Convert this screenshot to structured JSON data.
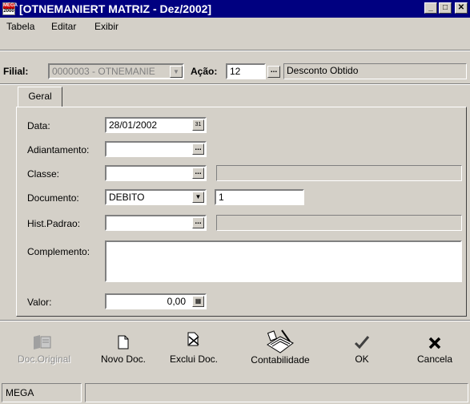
{
  "window": {
    "title": "[OTNEMANIERT MATRIZ - Dez/2002]",
    "app_icon_top": "MEGA",
    "app_icon_bottom": "2000"
  },
  "menu": [
    "Tabela",
    "Editar",
    "Exibir"
  ],
  "header": {
    "filial_label": "Filial:",
    "filial_value": "0000003 - OTNEMANIE",
    "acao_label": "Ação:",
    "acao_value": "12",
    "acao_description": "Desconto Obtido"
  },
  "tabs": [
    "Geral"
  ],
  "form": {
    "data_label": "Data:",
    "data_value": "28/01/2002",
    "adiantamento_label": "Adiantamento:",
    "adiantamento_value": "",
    "classe_label": "Classe:",
    "classe_value": "",
    "classe_description": "",
    "documento_label": "Documento:",
    "documento_value": "DEBITO",
    "documento_number": "1",
    "hist_label": "Hist.Padrao:",
    "hist_value": "",
    "hist_description": "",
    "complemento_label": "Complemento:",
    "complemento_value": "",
    "valor_label": "Valor:",
    "valor_value": "0,00"
  },
  "toolbar": {
    "doc_original": "Doc.Original",
    "novo_doc": "Novo Doc.",
    "exclui_doc": "Exclui Doc.",
    "contabilidade": "Contabilidade",
    "ok": "OK",
    "cancela": "Cancela"
  },
  "status": {
    "left": "MEGA",
    "right": ""
  },
  "icons": {
    "ellipsis": "...",
    "dropdown": "▼",
    "calendar": "calendar-icon",
    "calculator": "calculator-icon"
  }
}
